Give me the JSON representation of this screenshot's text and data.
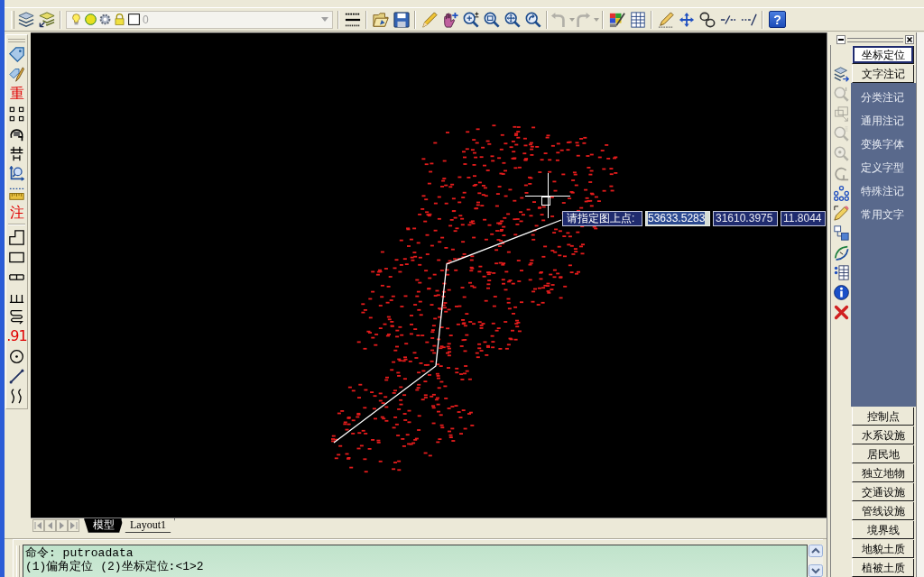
{
  "toolbar": {
    "layer_name": "0",
    "buttons": [
      {
        "kind": "icon",
        "disabled": false
      },
      {
        "kind": "icon",
        "disabled": false
      },
      {
        "kind": "icon",
        "disabled": false
      },
      {
        "kind": "icon",
        "disabled": false
      },
      {
        "kind": "icon",
        "disabled": false
      },
      {
        "kind": "icon",
        "disabled": false
      },
      {
        "kind": "icon",
        "disabled": false
      },
      {
        "kind": "icon",
        "disabled": false
      },
      {
        "kind": "icon",
        "disabled": false
      },
      {
        "kind": "icon",
        "disabled": false
      },
      {
        "kind": "icon",
        "disabled": false
      },
      {
        "kind": "icon",
        "disabled": true
      },
      {
        "kind": "icon",
        "disabled": true
      },
      {
        "kind": "icon",
        "disabled": false
      },
      {
        "kind": "icon",
        "disabled": false
      },
      {
        "kind": "icon",
        "disabled": false
      },
      {
        "kind": "icon",
        "disabled": false
      },
      {
        "kind": "icon",
        "disabled": false
      },
      {
        "kind": "icon",
        "disabled": false
      },
      {
        "kind": "icon",
        "disabled": false
      },
      {
        "kind": "text",
        "text": "?",
        "disabled": false
      }
    ]
  },
  "left_toolbar": {
    "buttons": [
      {
        "kind": "icon"
      },
      {
        "kind": "icon"
      },
      {
        "kind": "text",
        "text": "重"
      },
      {
        "kind": "icon"
      },
      {
        "kind": "icon"
      },
      {
        "kind": "icon"
      },
      {
        "kind": "icon"
      },
      {
        "kind": "icon"
      },
      {
        "kind": "text",
        "text": "注"
      },
      {
        "kind": "icon"
      },
      {
        "kind": "icon"
      },
      {
        "kind": "icon"
      },
      {
        "kind": "icon"
      },
      {
        "kind": "icon"
      },
      {
        "kind": "text",
        "text": ".91"
      },
      {
        "kind": "icon"
      },
      {
        "kind": "icon"
      },
      {
        "kind": "icon"
      }
    ]
  },
  "drawing": {
    "dynamic_input": {
      "prompt": "请指定图上点:",
      "fields": [
        {
          "value": "53633.5283",
          "selected": true
        },
        {
          "value": "31610.3975",
          "selected": false
        },
        {
          "value": "11.8044",
          "selected": false
        }
      ]
    }
  },
  "layout_tabs": [
    {
      "label": "模型",
      "selected": true
    },
    {
      "label": "Layout1",
      "selected": false
    }
  ],
  "command_line": {
    "lines": [
      "命令: putroadata",
      "(1)偏角定位 (2)坐标定位:<1>2"
    ]
  },
  "vertical_toolbar": {
    "buttons": [
      {
        "disabled": false
      },
      {
        "disabled": true
      },
      {
        "disabled": true
      },
      {
        "disabled": true
      },
      {
        "disabled": true
      },
      {
        "disabled": true
      },
      {
        "disabled": false
      },
      {
        "disabled": false
      },
      {
        "disabled": false
      },
      {
        "disabled": false
      },
      {
        "disabled": false
      },
      {
        "disabled": false
      },
      {
        "disabled": false
      }
    ]
  },
  "palette": {
    "categories": [
      {
        "label": "坐标定位",
        "selected": true,
        "expanded": false
      },
      {
        "label": "文字注记",
        "selected": false,
        "expanded": true,
        "items": [
          "分类注记",
          "通用注记",
          "变换字体",
          "定义字型",
          "特殊注记",
          "常用文字"
        ]
      },
      {
        "label": "控制点",
        "selected": false,
        "expanded": false
      },
      {
        "label": "水系设施",
        "selected": false,
        "expanded": false
      },
      {
        "label": "居民地",
        "selected": false,
        "expanded": false
      },
      {
        "label": "独立地物",
        "selected": false,
        "expanded": false
      },
      {
        "label": "交通设施",
        "selected": false,
        "expanded": false
      },
      {
        "label": "管线设施",
        "selected": false,
        "expanded": false
      },
      {
        "label": "境界线",
        "selected": false,
        "expanded": false
      },
      {
        "label": "地貌土质",
        "selected": false,
        "expanded": false
      },
      {
        "label": "植被土质",
        "selected": false,
        "expanded": false
      }
    ]
  }
}
